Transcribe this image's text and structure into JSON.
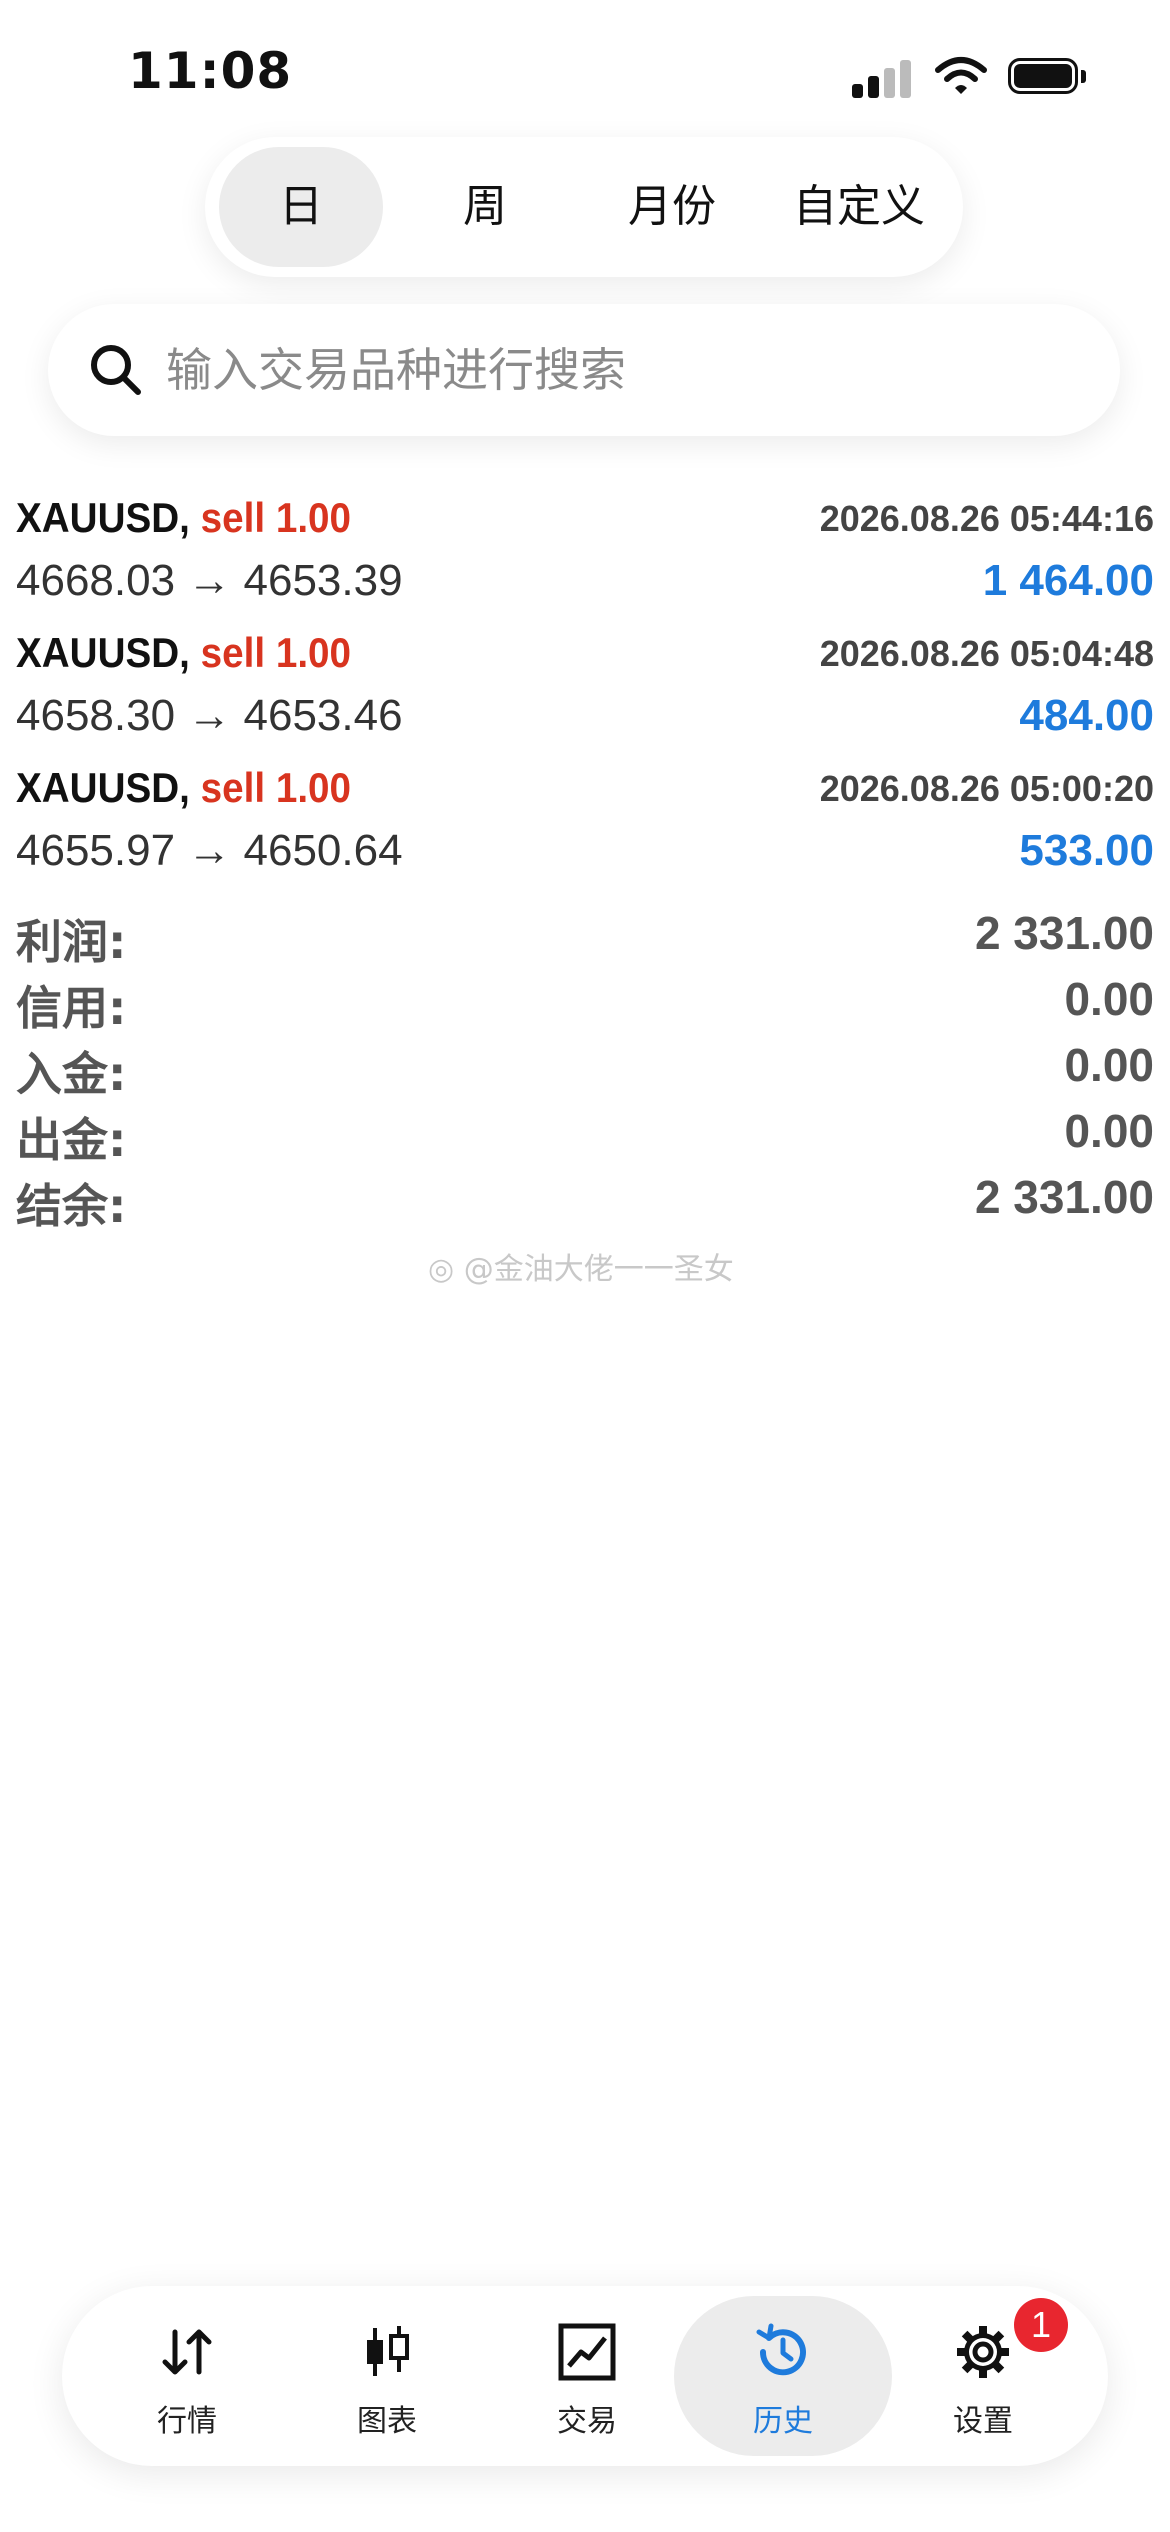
{
  "status_bar": {
    "time": "11:08"
  },
  "period_tabs": [
    {
      "label": "日",
      "active": true
    },
    {
      "label": "周",
      "active": false
    },
    {
      "label": "月份",
      "active": false
    },
    {
      "label": "自定义",
      "active": false
    }
  ],
  "search": {
    "placeholder": "输入交易品种进行搜索"
  },
  "trades": [
    {
      "symbol": "XAUUSD,",
      "side": "sell 1.00",
      "time": "2026.08.26 05:44:16",
      "prices": "4668.03 → 4653.39",
      "profit": "1 464.00"
    },
    {
      "symbol": "XAUUSD,",
      "side": "sell 1.00",
      "time": "2026.08.26 05:04:48",
      "prices": "4658.30 → 4653.46",
      "profit": "484.00"
    },
    {
      "symbol": "XAUUSD,",
      "side": "sell 1.00",
      "time": "2026.08.26 05:00:20",
      "prices": "4655.97 → 4650.64",
      "profit": "533.00"
    }
  ],
  "summary": [
    {
      "label": "利润:",
      "value": "2 331.00"
    },
    {
      "label": "信用:",
      "value": "0.00"
    },
    {
      "label": "入金:",
      "value": "0.00"
    },
    {
      "label": "出金:",
      "value": "0.00"
    },
    {
      "label": "结余:",
      "value": "2 331.00"
    }
  ],
  "watermark": "@金油大佬一一圣女",
  "bottom_nav": {
    "items": [
      {
        "label": "行情",
        "icon": "quotes-arrows-icon",
        "active": false
      },
      {
        "label": "图表",
        "icon": "candlestick-chart-icon",
        "active": false
      },
      {
        "label": "交易",
        "icon": "trade-chart-icon",
        "active": false
      },
      {
        "label": "历史",
        "icon": "history-clock-icon",
        "active": true
      },
      {
        "label": "设置",
        "icon": "gear-icon",
        "active": false,
        "badge": "1"
      }
    ]
  },
  "colors": {
    "sell": "#d8341f",
    "profit": "#1e7bdc",
    "active_nav": "#1e7bdc",
    "badge": "#e8262f"
  }
}
